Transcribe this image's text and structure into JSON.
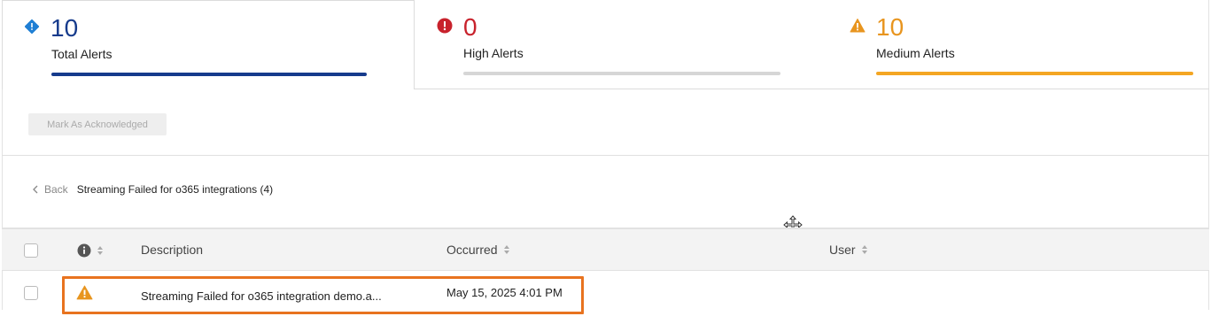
{
  "summary": {
    "total": {
      "count": "10",
      "label": "Total Alerts",
      "color": "#163b8c",
      "icon": "diamond-info-icon"
    },
    "high": {
      "count": "0",
      "label": "High Alerts",
      "color": "#c8222c",
      "icon": "circle-exclamation-icon"
    },
    "medium": {
      "count": "10",
      "label": "Medium Alerts",
      "color": "#f4a623",
      "icon": "warning-triangle-icon"
    }
  },
  "toolbar": {
    "acknowledge_label": "Mark As Acknowledged"
  },
  "breadcrumb": {
    "back_label": "Back",
    "title": "Streaming Failed for o365 integrations (4)"
  },
  "table": {
    "columns": [
      "Description",
      "Occurred",
      "User"
    ],
    "rows": [
      {
        "severity_icon": "warning-triangle-icon",
        "description": "Streaming Failed for o365 integration demo.a...",
        "occurred": "May 15, 2025 4:01 PM",
        "user": ""
      }
    ]
  }
}
